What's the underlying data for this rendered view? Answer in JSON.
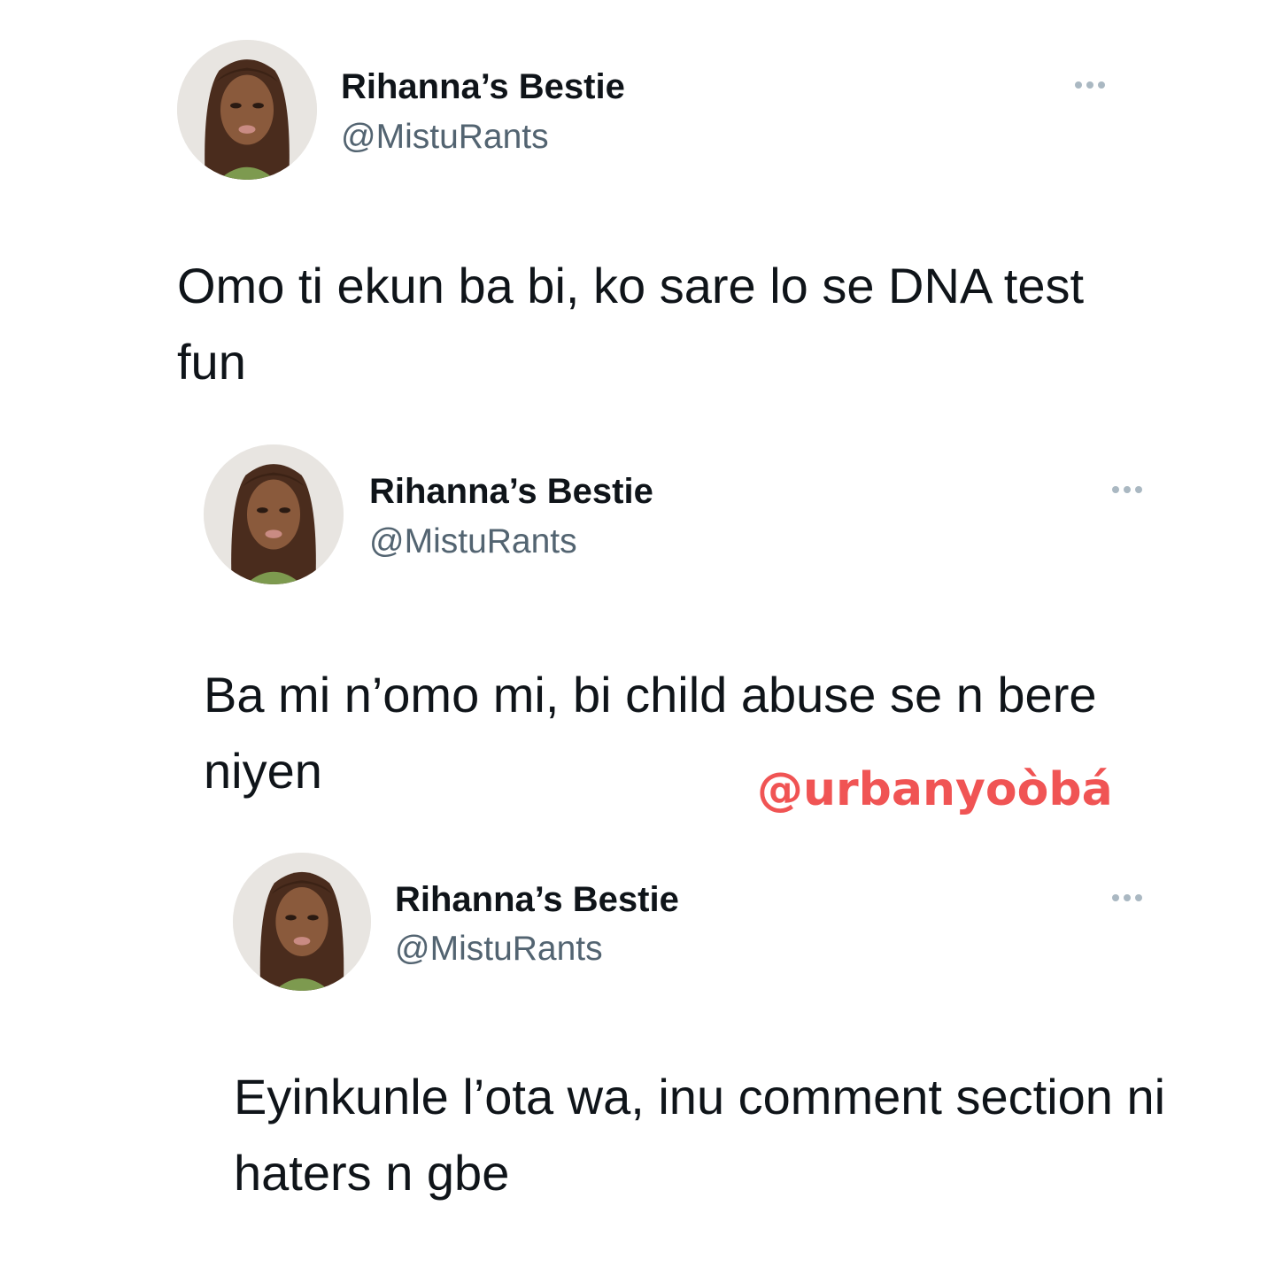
{
  "tweets": [
    {
      "display_name": "Rihanna’s Bestie",
      "handle": "@MistuRants",
      "text": "Omo ti ekun ba bi, ko sare lo se DNA test fun",
      "more_icon": "more-options-icon"
    },
    {
      "display_name": "Rihanna’s Bestie",
      "handle": "@MistuRants",
      "text": "Ba mi n’omo mi, bi child abuse se n bere niyen",
      "more_icon": "more-options-icon"
    },
    {
      "display_name": "Rihanna’s Bestie",
      "handle": "@MistuRants",
      "text": "Eyinkunle l’ota wa, inu comment section ni haters n gbe",
      "more_icon": "more-options-icon"
    }
  ],
  "watermark": "@urbanyoòbá",
  "colors": {
    "background": "#ffffff",
    "text": "#0f1419",
    "handle": "#536471",
    "more_dots": "#aab8c2",
    "watermark": "#f05454"
  }
}
